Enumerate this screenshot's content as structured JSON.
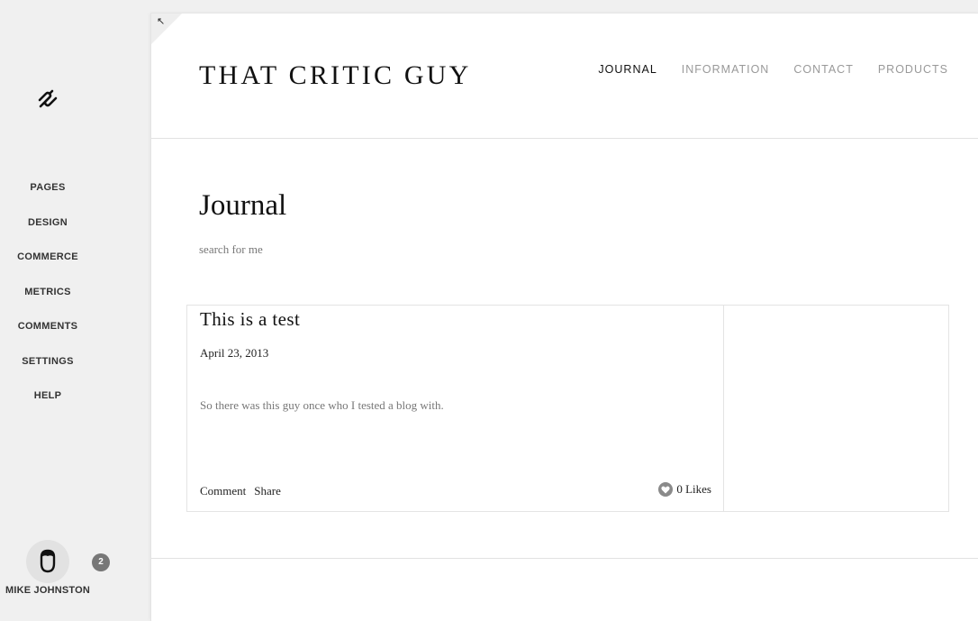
{
  "sidebar": {
    "logo": "squarespace-logo",
    "items": [
      {
        "label": "PAGES"
      },
      {
        "label": "DESIGN"
      },
      {
        "label": "COMMERCE"
      },
      {
        "label": "METRICS"
      },
      {
        "label": "COMMENTS"
      },
      {
        "label": "SETTINGS"
      },
      {
        "label": "HELP"
      }
    ],
    "user": {
      "name": "MIKE JOHNSTON",
      "avatar_icon": "user-avatar-icon",
      "notification_count": "2"
    }
  },
  "site": {
    "corner_icon": "collapse-arrow-icon",
    "title": "THAT CRITIC GUY",
    "nav": [
      {
        "label": "JOURNAL",
        "active": true
      },
      {
        "label": "INFORMATION",
        "active": false
      },
      {
        "label": "CONTACT",
        "active": false
      },
      {
        "label": "PRODUCTS",
        "active": false
      }
    ],
    "page_title": "Journal",
    "page_description": "search for me",
    "posts": [
      {
        "title": "This is a test",
        "date": "April 23, 2013",
        "excerpt": "So there was this guy once who I tested a blog with.",
        "comment_label": "Comment",
        "share_label": "Share",
        "likes_label": "0 Likes",
        "likes_icon": "heart-icon"
      }
    ]
  },
  "colors": {
    "sidebar_bg": "#f0f0f0",
    "content_bg": "#ffffff",
    "nav_active": "#111111",
    "nav_inactive": "#999999",
    "badge_bg": "#777777"
  }
}
